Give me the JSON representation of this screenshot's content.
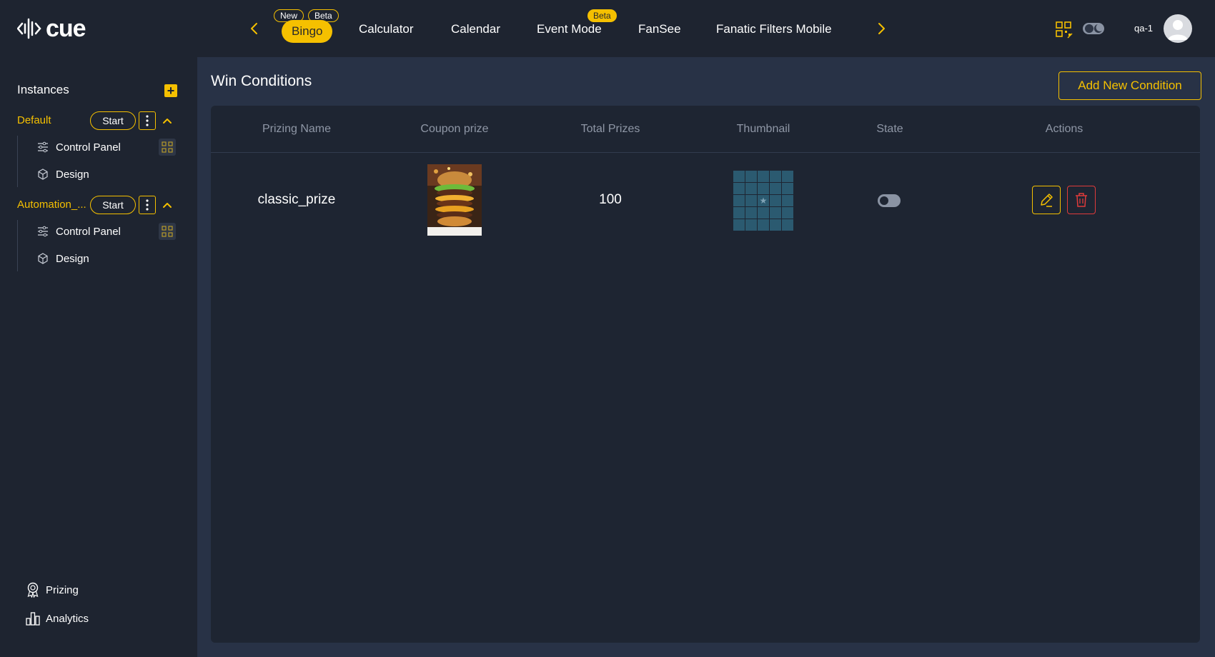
{
  "brand": {
    "logo_text": "cue"
  },
  "topnav": {
    "items": [
      {
        "label": "Bingo",
        "badges": [
          "New",
          "Beta"
        ],
        "active": true
      },
      {
        "label": "Calculator"
      },
      {
        "label": "Calendar"
      },
      {
        "label": "Event Mode",
        "badges": [
          "Beta"
        ]
      },
      {
        "label": "FanSee"
      },
      {
        "label": "Fanatic Filters Mobile"
      }
    ],
    "badge_new": "New",
    "badge_beta": "Beta",
    "badge_beta2": "Beta"
  },
  "user": {
    "name": "qa-1"
  },
  "sidebar": {
    "instances_title": "Instances",
    "add_label": "+",
    "instances": [
      {
        "name": "Default",
        "start_label": "Start",
        "children": [
          "Control Panel",
          "Design"
        ]
      },
      {
        "name": "Automation_...",
        "start_label": "Start",
        "children": [
          "Control Panel",
          "Design"
        ]
      }
    ],
    "bottom_links": [
      {
        "label": "Prizing",
        "icon": "award-icon"
      },
      {
        "label": "Analytics",
        "icon": "bar-chart-icon"
      }
    ]
  },
  "main": {
    "title": "Win Conditions",
    "add_button_label": "Add New Condition",
    "table": {
      "headers": [
        "Prizing Name",
        "Coupon prize",
        "Total Prizes",
        "Thumbnail",
        "State",
        "Actions"
      ],
      "rows": [
        {
          "prizing_name": "classic_prize",
          "coupon_prize": "burger-image",
          "total_prizes": "100",
          "thumbnail": "bingo-grid-icon",
          "state": false
        }
      ]
    }
  },
  "colors": {
    "accent": "#f5c000",
    "danger": "#e03b3b",
    "bg": "#1e2430",
    "panel": "#283246",
    "card": "#1e2532"
  }
}
